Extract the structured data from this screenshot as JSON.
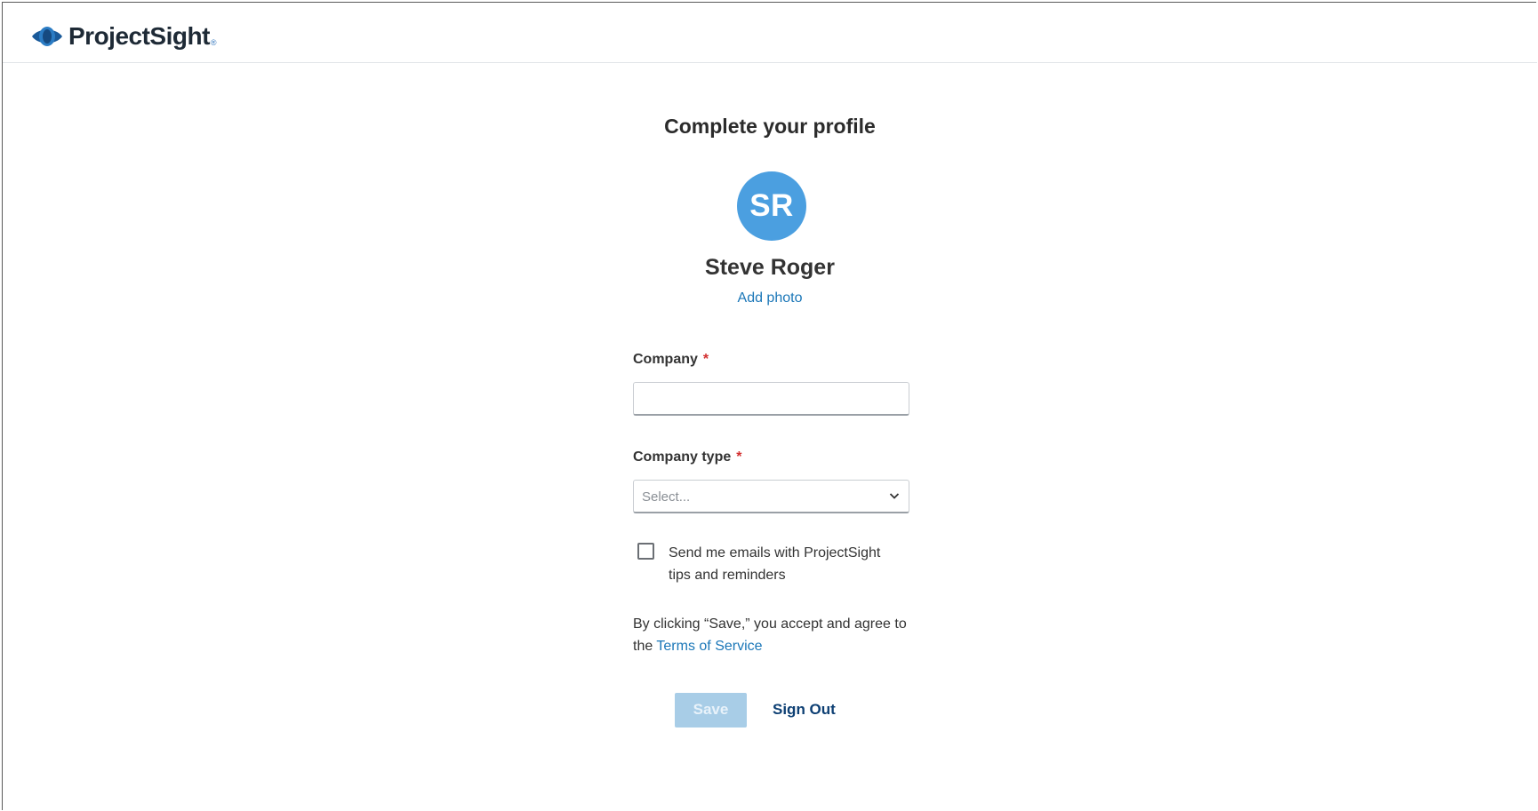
{
  "header": {
    "logo_text": "ProjectSight",
    "logo_reg": "®",
    "icon": "projectsight-logo-icon"
  },
  "profile": {
    "title": "Complete your profile",
    "initials": "SR",
    "name": "Steve Roger",
    "add_photo": "Add photo",
    "avatar_color": "#4b9fe0"
  },
  "form": {
    "company": {
      "label": "Company",
      "required_mark": "*",
      "value": "",
      "placeholder": ""
    },
    "company_type": {
      "label": "Company type",
      "required_mark": "*",
      "selected": "Select..."
    },
    "emails_checkbox": {
      "checked": false,
      "label": "Send me emails with ProjectSight tips and reminders"
    },
    "terms": {
      "prefix": "By clicking “Save,” you accept and agree to the",
      "link": "Terms of Service"
    }
  },
  "actions": {
    "save": "Save",
    "sign_out": "Sign Out"
  },
  "colors": {
    "link": "#1b77b8",
    "required": "#d22f2f",
    "save_disabled": "#a8cde7",
    "sign_out": "#0d3f73"
  }
}
